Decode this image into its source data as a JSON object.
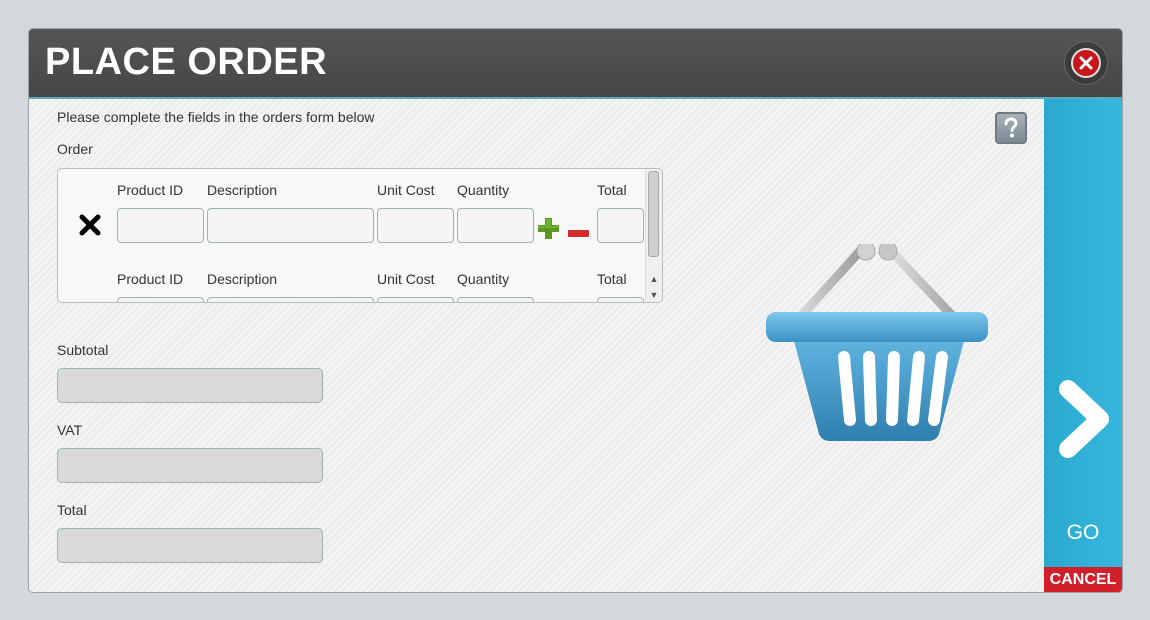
{
  "window": {
    "title": "PLACE ORDER"
  },
  "form": {
    "instructions": "Please complete the fields in the orders form below",
    "order_label": "Order",
    "columns": {
      "product_id": "Product ID",
      "description": "Description",
      "unit_cost": "Unit Cost",
      "quantity": "Quantity",
      "total": "Total"
    },
    "rows": [
      {
        "product_id": "",
        "description": "",
        "unit_cost": "",
        "quantity": "",
        "total": ""
      },
      {
        "product_id": "",
        "description": "",
        "unit_cost": "",
        "quantity": "",
        "total": ""
      }
    ],
    "subtotal_label": "Subtotal",
    "vat_label": "VAT",
    "total_label": "Total",
    "subtotal_value": "",
    "vat_value": "",
    "total_value": ""
  },
  "actions": {
    "go_label": "GO",
    "cancel_label": "CANCEL"
  },
  "icons": {
    "close": "close-icon",
    "help": "help-icon",
    "remove_row": "remove-row-icon",
    "increase": "plus-icon",
    "decrease": "minus-icon",
    "go": "chevron-right-icon",
    "basket": "shopping-basket-icon"
  },
  "colors": {
    "title_bar": "#4d4d4d",
    "go_panel": "#33b3da",
    "cancel": "#d2202a",
    "close": "#c8161d",
    "plus": "#5a9a1e",
    "minus": "#d42b2b",
    "basket": "#3a92c1"
  }
}
